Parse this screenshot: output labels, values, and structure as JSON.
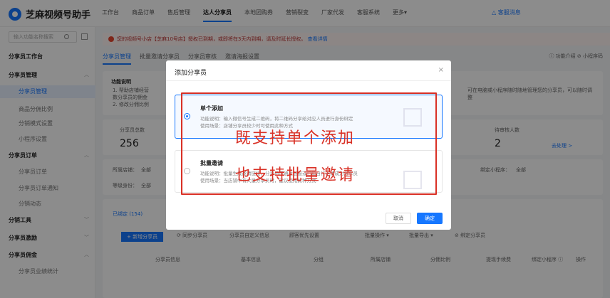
{
  "app": {
    "title": "芝麻视频号助手"
  },
  "topnav": [
    "工作台",
    "商品订单",
    "售后管理",
    "达人分享员",
    "本地团购券",
    "营销裂变",
    "厂家代发",
    "客服系统",
    "更多▾"
  ],
  "topnav_active": 3,
  "top_notice": "△ 客服消息",
  "search": {
    "placeholder": "输入功能名称搜索"
  },
  "sidebar": {
    "workbench": "分享员工作台",
    "group1": "分享员管理",
    "g1items": [
      "分享员管理",
      "商品分佣比例",
      "分销模式设置",
      "小程序设置"
    ],
    "group2": "分享员订单",
    "g2items": [
      "分享员订单",
      "分享员订单通知",
      "分销动态"
    ],
    "group3": "分销工具",
    "group4": "分享员激励",
    "group5": "分享员佣金",
    "g5items": [
      "分享员业绩统计"
    ]
  },
  "alert": {
    "text": "您的视频号小店【芝麻10号店】授权已到期，或即将在3天内到期，请及时延长授权。",
    "link": "查看详情"
  },
  "tabs": [
    "分享员管理",
    "批量邀请分享员",
    "分享员审核",
    "邀请海报设置"
  ],
  "help": "ⓘ 功能介绍  ⊘ 小程序码",
  "bg": {
    "info_title": "功能说明",
    "info1": "1. 帮助店铺经营",
    "info2": "数分享员的佣金",
    "info3": "2. 修改分佣比例",
    "info_right": "可在电脑或小程序随时随地管理您的分享员，可以随时调",
    "info_right2": "整",
    "total_label": "分享员总数",
    "total_value": "256",
    "pending_label": "待审核人数",
    "pending_value": "2",
    "go": "去处理 >",
    "store_label": "所属店铺：",
    "store_value": "全部",
    "level_label": "等级身份：",
    "level_value": "全部",
    "mini_label": "绑定小程序：",
    "mini_value": "全部",
    "bound_tab": "已绑定 (154)",
    "add_btn": "+ 新增分享员",
    "sync_btn": "⟳ 同步分享员",
    "custom_btn": "分享员自定义信息",
    "priority": "顾客优先设置",
    "batch_op": "批量操作 ▾",
    "batch_export": "批量导出 ▾",
    "bind": "⊘ 绑定分享员",
    "col_info": "分享员信息",
    "col_basic": "基本信息",
    "col_group": "分组",
    "col_store": "所属店铺",
    "col_ratio": "分佣比例",
    "col_fee": "提现手续费",
    "col_mini": "绑定小程序 ⓘ",
    "col_op": "操作"
  },
  "modal": {
    "title": "添加分享员",
    "close": "×",
    "opt1_title": "单个添加",
    "opt1_desc1": "功能说明：输入微信号生成二维码，将二维码分享给对应人员进行身份绑定",
    "opt1_desc2": "使用场景：店铺分享员较少时可使用此种方式",
    "opt2_title": "批量邀请",
    "opt2_desc1": "功能说明：批量生成邀请链接，分享员可通过链接或扫码自行申请成为分享员",
    "opt2_desc2": "使用场景：当店铺中有大量分享员时，建议使用此种方式",
    "cancel": "取消",
    "ok": "确定"
  },
  "annotations": {
    "line1": "既支持单个添加",
    "line2": "也支持批量邀请"
  },
  "colors": {
    "accent": "#1677ff",
    "annotation": "#d93025"
  }
}
